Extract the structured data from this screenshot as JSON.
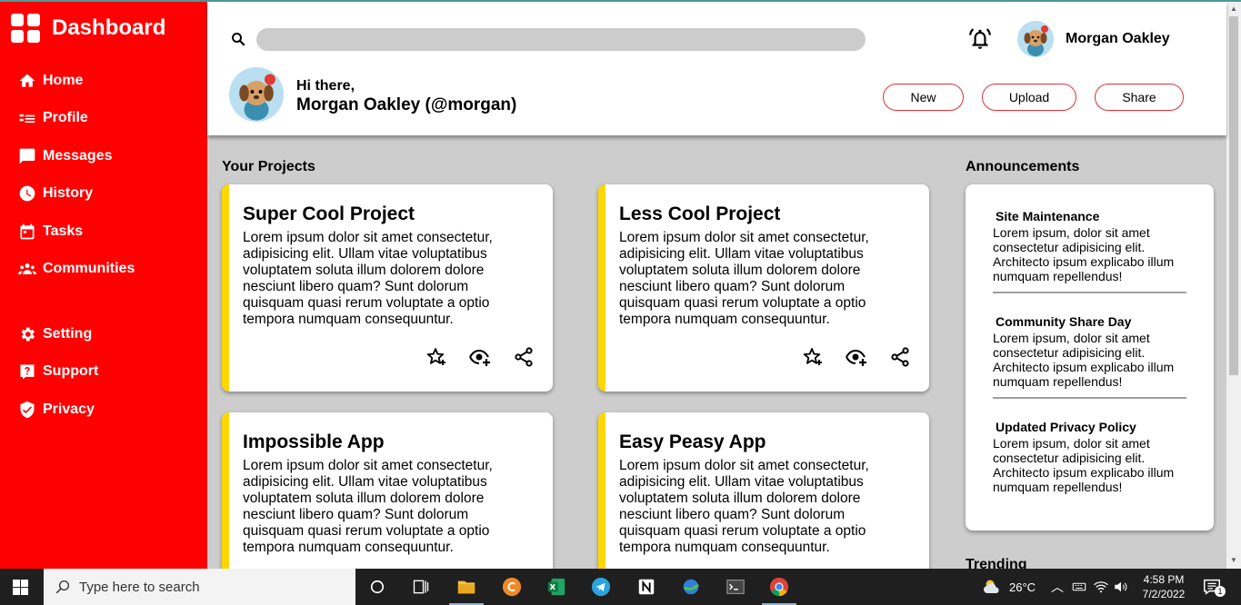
{
  "sidebar": {
    "brand": "Dashboard",
    "items": [
      {
        "label": "Home",
        "icon": "home-icon"
      },
      {
        "label": "Profile",
        "icon": "profile-icon"
      },
      {
        "label": "Messages",
        "icon": "messages-icon"
      },
      {
        "label": "History",
        "icon": "history-icon"
      },
      {
        "label": "Tasks",
        "icon": "tasks-icon"
      },
      {
        "label": "Communities",
        "icon": "communities-icon"
      },
      {
        "label": "Setting",
        "icon": "gear-icon"
      },
      {
        "label": "Support",
        "icon": "support-icon"
      },
      {
        "label": "Privacy",
        "icon": "shield-icon"
      }
    ]
  },
  "header": {
    "search_value": "",
    "user_name": "Morgan Oakley",
    "greeting": "Hi there,",
    "greeting_name": "Morgan Oakley (@morgan)",
    "buttons": {
      "new": "New",
      "upload": "Upload",
      "share": "Share"
    }
  },
  "projects": {
    "title": "Your Projects",
    "items": [
      {
        "title": "Super Cool Project",
        "body": "Lorem ipsum dolor sit amet consectetur, adipisicing elit. Ullam vitae voluptatibus voluptatem soluta illum dolorem dolore nesciunt libero quam? Sunt dolorum quisquam quasi rerum voluptate a optio tempora numquam consequuntur."
      },
      {
        "title": "Less Cool Project",
        "body": "Lorem ipsum dolor sit amet consectetur, adipisicing elit. Ullam vitae voluptatibus voluptatem soluta illum dolorem dolore nesciunt libero quam? Sunt dolorum quisquam quasi rerum voluptate a optio tempora numquam consequuntur."
      },
      {
        "title": "Impossible App",
        "body": "Lorem ipsum dolor sit amet consectetur, adipisicing elit. Ullam vitae voluptatibus voluptatem soluta illum dolorem dolore nesciunt libero quam? Sunt dolorum quisquam quasi rerum voluptate a optio tempora numquam consequuntur."
      },
      {
        "title": "Easy Peasy App",
        "body": "Lorem ipsum dolor sit amet consectetur, adipisicing elit. Ullam vitae voluptatibus voluptatem soluta illum dolorem dolore nesciunt libero quam? Sunt dolorum quisquam quasi rerum voluptate a optio tempora numquam consequuntur."
      }
    ]
  },
  "announcements": {
    "title": "Announcements",
    "items": [
      {
        "title": "Site Maintenance",
        "body": "Lorem ipsum, dolor sit amet consectetur adipisicing elit. Architecto ipsum explicabo illum numquam repellendus!"
      },
      {
        "title": "Community Share Day",
        "body": "Lorem ipsum, dolor sit amet consectetur adipisicing elit. Architecto ipsum explicabo illum numquam repellendus!"
      },
      {
        "title": "Updated Privacy Policy",
        "body": "Lorem ipsum, dolor sit amet consectetur adipisicing elit. Architecto ipsum explicabo illum numquam repellendus!"
      }
    ]
  },
  "trending": {
    "title": "Trending"
  },
  "taskbar": {
    "search_placeholder": "Type here to search",
    "weather": "26°C",
    "time": "4:58 PM",
    "date": "7/2/2022",
    "notifications": "1"
  },
  "colors": {
    "sidebar": "#ff0000",
    "card_accent": "#ffd700",
    "pill_border": "#e0313a",
    "main_bg": "#cdcdcd"
  }
}
